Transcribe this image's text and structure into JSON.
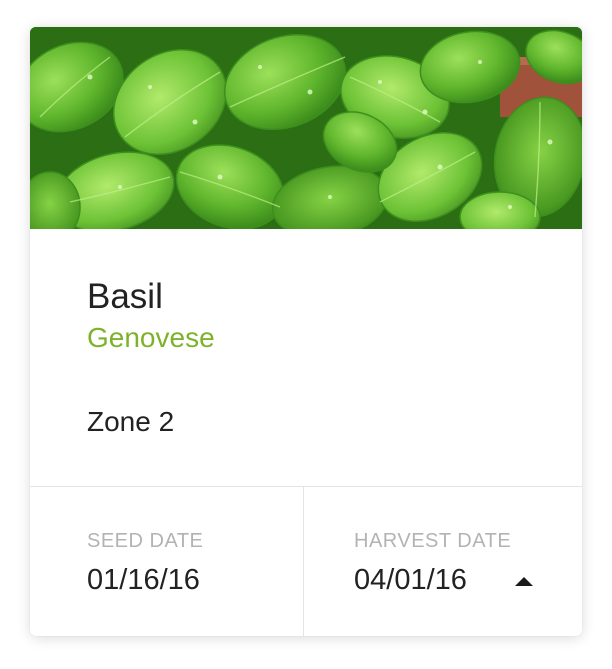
{
  "plant": {
    "name": "Basil",
    "variety": "Genovese",
    "zone": "Zone 2",
    "image_subject": "basil-leaves-photo"
  },
  "dates": {
    "seed_label": "SEED DATE",
    "seed_value": "01/16/16",
    "harvest_label": "HARVEST DATE",
    "harvest_value": "04/01/16",
    "toggle_icon": "caret-up-icon"
  },
  "colors": {
    "variety_green": "#7db32a",
    "label_gray": "#b3b3b3",
    "text_dark": "#222222",
    "divider": "#e4e4e4"
  }
}
